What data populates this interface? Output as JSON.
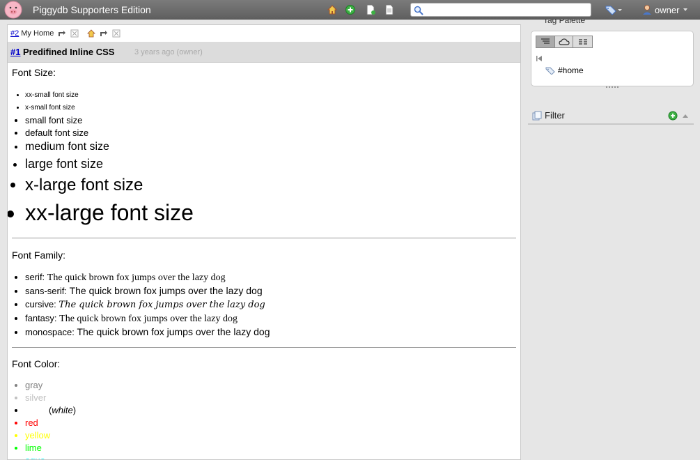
{
  "header": {
    "app_title": "Piggydb Supporters Edition",
    "search_placeholder": "",
    "user_name": "owner"
  },
  "breadcrumb": {
    "id_link": "#2",
    "title": "My Home"
  },
  "fragment": {
    "id": "#1",
    "title": "Predifined Inline CSS",
    "meta": "3 years ago (owner)"
  },
  "sections": {
    "size_title": "Font Size:",
    "sizes": [
      "xx-small font size",
      "x-small font size",
      "small font size",
      "default font size",
      "medium font size",
      "large font size",
      "x-large font size",
      "xx-large font size"
    ],
    "family_title": "Font Family:",
    "families": [
      {
        "label": "serif:",
        "sample": "The quick brown fox jumps over the lazy dog"
      },
      {
        "label": "sans-serif:",
        "sample": "The quick brown fox jumps over the lazy dog"
      },
      {
        "label": "cursive:",
        "sample": "The quick brown fox jumps over the lazy dog"
      },
      {
        "label": "fantasy:",
        "sample": "The quick brown fox jumps over the lazy dog"
      },
      {
        "label": "monospace:",
        "sample": "The quick brown fox jumps over the lazy dog"
      }
    ],
    "color_title": "Font Color:",
    "colors": {
      "gray": "gray",
      "silver": "silver",
      "white_paren_open": "(",
      "white_word": "white",
      "white_paren_close": ")",
      "red": "red",
      "yellow": "yellow",
      "lime": "lime",
      "aqua": "aqua"
    }
  },
  "palette": {
    "title": "Tag Palette",
    "home_tag": "#home"
  },
  "filter": {
    "title": "Filter"
  },
  "colors": {
    "link": "#0000cc",
    "header_bg": "#6b6b6b",
    "gray": "#808080",
    "silver": "#c0c0c0",
    "red": "#ff0000",
    "yellow": "#ffff00",
    "lime": "#00ff00",
    "aqua": "#00ffff"
  },
  "icons": [
    "logo-pig-icon",
    "home-icon",
    "add-icon",
    "new-document-icon",
    "document-icon",
    "search-icon",
    "tag-icon",
    "user-icon",
    "filter-icon",
    "back-icon",
    "tag-small-icon"
  ]
}
